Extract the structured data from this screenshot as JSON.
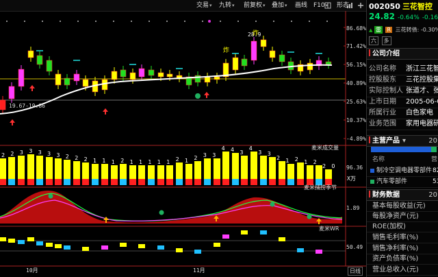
{
  "toolbar": {
    "buttons": [
      {
        "label": "交易",
        "caret": "▾"
      },
      {
        "label": "九转",
        "caret": "▾"
      },
      {
        "label": "前复权",
        "caret": "▾"
      },
      {
        "label": "叠加",
        "caret": "▾"
      },
      {
        "label": "画线",
        "caret": ""
      },
      {
        "label": "F10",
        "caret": "▾"
      },
      {
        "label": "形态",
        "caret": ""
      }
    ],
    "icons": [
      "book-icon",
      "bars-icon",
      "plus-icon"
    ]
  },
  "chart_data": {
    "type": "candlestick",
    "price_axis": [
      "86.68%",
      "71.42%",
      "56.15%",
      "40.89%",
      "25.63%",
      "10.37%",
      "-4.89%"
    ],
    "price_annotations": {
      "low_label": "19.67-19.86",
      "high_label": "28.9",
      "zha": [
        "炸",
        "炸"
      ]
    },
    "x_labels": [
      "10月",
      "11月"
    ],
    "volume_panel": {
      "label": "麦米成交量",
      "axis": [
        "96.36"
      ],
      "unit": "X万",
      "count_labels": [
        "2",
        "2",
        "3",
        "3",
        "3",
        "3",
        "3",
        "2",
        "2",
        "2",
        "1",
        "1",
        "1",
        "2",
        "1",
        "1",
        "1",
        "1",
        "1",
        "2",
        "1",
        "2",
        "3",
        "3",
        "4",
        "4",
        "3",
        "4",
        "3",
        "3",
        "2",
        "1",
        "2",
        "1",
        "2",
        "2",
        "0"
      ]
    },
    "season_panel": {
      "label": "麦米捕捞季节",
      "axis": [
        "1.89"
      ]
    },
    "wr_panel": {
      "label": "麦米WR",
      "axis": [
        "50.49"
      ]
    },
    "period_button": "日线"
  },
  "quote": {
    "code": "002050",
    "name": "三花智控",
    "price": "24.82",
    "pct": "-0.64%",
    "change": "-0.16",
    "tags": [
      {
        "text": "雷",
        "color": "#18a018"
      },
      {
        "text": "R",
        "color": "#d07010"
      }
    ],
    "bond": "三花转债: -0.30%",
    "six_label": "六",
    "duo_label": "多"
  },
  "company": {
    "title": "公司介绍",
    "rows": [
      {
        "k": "公司名称",
        "v": "浙江三花智控"
      },
      {
        "k": "控股股东",
        "v": "三花控股集团"
      },
      {
        "k": "实际控制人",
        "v": "张道才、张亚"
      },
      {
        "k": "上市日期",
        "v": "2005-06-07"
      },
      {
        "k": "所属行业",
        "v": "白色家电"
      },
      {
        "k": "业务范围",
        "v": "家用电器研发"
      }
    ]
  },
  "products": {
    "title": "主营产品",
    "selector": "▾",
    "year": "20",
    "cols": [
      "名称",
      "营"
    ],
    "rows": [
      {
        "name": "制冷空调电器零部件",
        "val": "82",
        "color": "#1e5fd8"
      },
      {
        "name": "汽车零部件",
        "val": "53",
        "color": "#20b060"
      }
    ]
  },
  "finance": {
    "title": "财务数据",
    "year": "20",
    "items": [
      "基本每股收益(元)",
      "每股净资产(元)",
      "ROE(加权)",
      "销售毛利率(%)",
      "销售净利率(%)",
      "资产负债率(%)",
      "营业总收入(元)"
    ]
  }
}
